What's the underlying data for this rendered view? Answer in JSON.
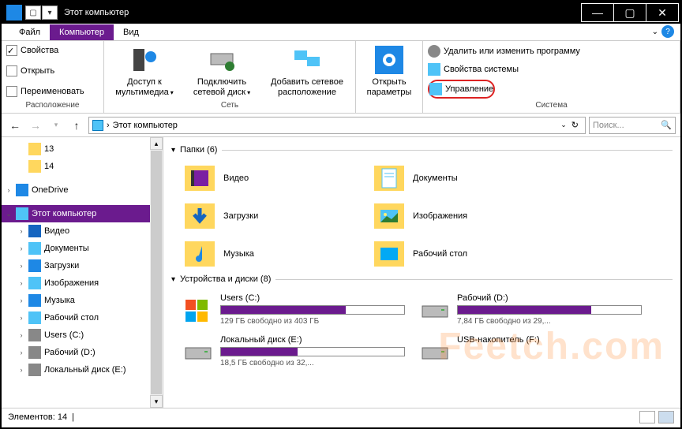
{
  "window": {
    "title": "Этот компьютер"
  },
  "tabs": {
    "file": "Файл",
    "computer": "Компьютер",
    "view": "Вид"
  },
  "ribbon": {
    "group1": {
      "title": "Расположение",
      "props": "Свойства",
      "open": "Открыть",
      "rename": "Переименовать"
    },
    "group2": {
      "title": "Сеть",
      "media_access": "Доступ к мультимедиа",
      "connect_net": "Подключить сетевой диск",
      "add_net_loc": "Добавить сетевое расположение"
    },
    "group3": {
      "open_params": "Открыть параметры"
    },
    "group4": {
      "title": "Система",
      "remove_prog": "Удалить или изменить программу",
      "sys_props": "Свойства системы",
      "manage": "Управление"
    }
  },
  "address": {
    "path": "Этот компьютер",
    "sep": "›",
    "search_placeholder": "Поиск..."
  },
  "sidebar": {
    "items": [
      {
        "label": "13",
        "type": "folder",
        "level": 2
      },
      {
        "label": "14",
        "type": "folder",
        "level": 2
      },
      {
        "label": "OneDrive",
        "type": "onedrive",
        "level": 1,
        "expandable": true
      },
      {
        "label": "Этот компьютер",
        "type": "pc",
        "level": 1,
        "selected": true,
        "expandable": true,
        "expanded": true
      },
      {
        "label": "Видео",
        "type": "video",
        "level": 2,
        "expandable": true
      },
      {
        "label": "Документы",
        "type": "docs",
        "level": 2,
        "expandable": true
      },
      {
        "label": "Загрузки",
        "type": "downloads",
        "level": 2,
        "expandable": true
      },
      {
        "label": "Изображения",
        "type": "pictures",
        "level": 2,
        "expandable": true
      },
      {
        "label": "Музыка",
        "type": "music",
        "level": 2,
        "expandable": true
      },
      {
        "label": "Рабочий стол",
        "type": "desktop",
        "level": 2,
        "expandable": true
      },
      {
        "label": "Users (C:)",
        "type": "drive",
        "level": 2,
        "expandable": true
      },
      {
        "label": "Рабочий (D:)",
        "type": "drive",
        "level": 2,
        "expandable": true
      },
      {
        "label": "Локальный диск (E:)",
        "type": "drive",
        "level": 2,
        "expandable": true
      }
    ]
  },
  "sections": {
    "folders": {
      "header": "Папки (6)",
      "items": [
        "Видео",
        "Документы",
        "Загрузки",
        "Изображения",
        "Музыка",
        "Рабочий стол"
      ]
    },
    "drives": {
      "header": "Устройства и диски (8)",
      "items": [
        {
          "name": "Users (C:)",
          "free": "129 ГБ свободно из 403 ГБ",
          "fill": 68
        },
        {
          "name": "Рабочий (D:)",
          "free": "7,84 ГБ свободно из 29,...",
          "fill": 73
        },
        {
          "name": "Локальный диск (E:)",
          "free": "18,5 ГБ свободно из 32,...",
          "fill": 42
        },
        {
          "name": "USB-накопитель (F:)",
          "free": "",
          "fill": 0,
          "nobar": true
        }
      ]
    }
  },
  "status": {
    "items": "Элементов: 14"
  },
  "watermark": "Feetch.com"
}
